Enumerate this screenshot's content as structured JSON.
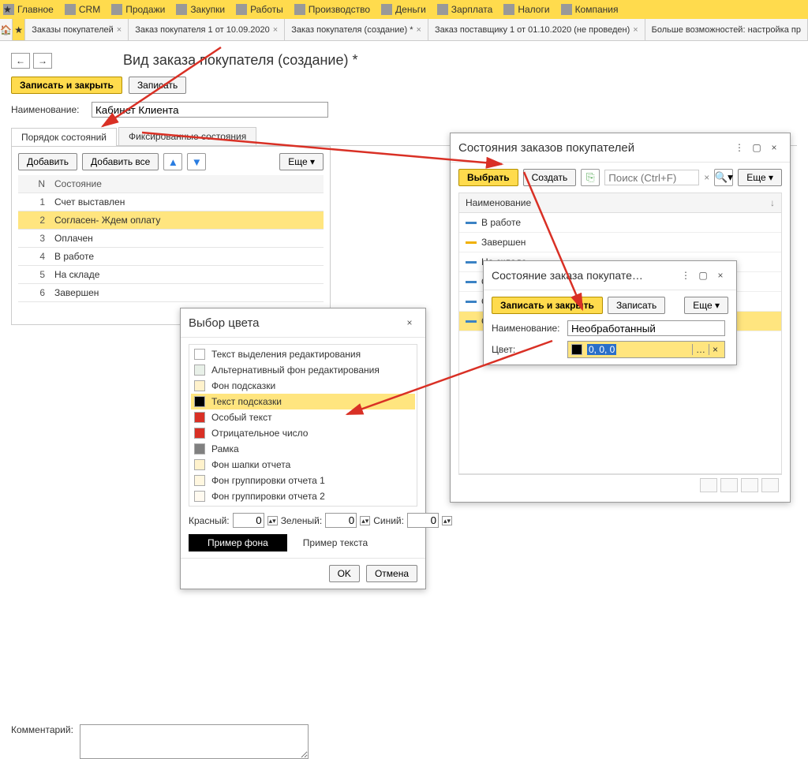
{
  "topmenu": [
    "Главное",
    "CRM",
    "Продажи",
    "Закупки",
    "Работы",
    "Производство",
    "Деньги",
    "Зарплата",
    "Налоги",
    "Компания"
  ],
  "tabs": [
    {
      "label": "Заказы покупателей",
      "close": true
    },
    {
      "label": "Заказ покупателя 1 от 10.09.2020",
      "close": true
    },
    {
      "label": "Заказ покупателя (создание) *",
      "close": true
    },
    {
      "label": "Заказ поставщику 1 от 01.10.2020 (не проведен)",
      "close": true
    },
    {
      "label": "Больше возможностей: настройка пр",
      "close": false
    }
  ],
  "page": {
    "title": "Вид заказа покупателя (создание) *",
    "save_close": "Записать и закрыть",
    "save": "Записать",
    "name_label": "Наименование:",
    "name_value": "Кабинет Клиента",
    "subtab1": "Порядок состояний",
    "subtab2": "Фиксированные состояния",
    "add": "Добавить",
    "add_all": "Добавить все",
    "more": "Еще",
    "col_n": "N",
    "col_state": "Состояние",
    "rows": [
      {
        "n": "1",
        "s": "Счет выставлен"
      },
      {
        "n": "2",
        "s": "Согласен- Ждем оплату"
      },
      {
        "n": "3",
        "s": "Оплачен"
      },
      {
        "n": "4",
        "s": "В работе"
      },
      {
        "n": "5",
        "s": "На складе"
      },
      {
        "n": "6",
        "s": "Завершен"
      }
    ],
    "comment_label": "Комментарий:"
  },
  "color_popup": {
    "title": "Выбор цвета",
    "items": [
      {
        "c": "#ffffff",
        "t": "Текст выделения редактирования"
      },
      {
        "c": "#e8f0e8",
        "t": "Альтернативный фон редактирования"
      },
      {
        "c": "#fff2cc",
        "t": "Фон подсказки"
      },
      {
        "c": "#000000",
        "t": "Текст подсказки"
      },
      {
        "c": "#d93025",
        "t": "Особый текст"
      },
      {
        "c": "#d93025",
        "t": "Отрицательное число"
      },
      {
        "c": "#808080",
        "t": "Рамка"
      },
      {
        "c": "#fff2cc",
        "t": "Фон шапки отчета"
      },
      {
        "c": "#fff7e0",
        "t": "Фон группировки отчета 1"
      },
      {
        "c": "#fffaf0",
        "t": "Фон группировки отчета 2"
      }
    ],
    "selected_index": 3,
    "red_label": "Красный:",
    "green_label": "Зеленый:",
    "blue_label": "Синий:",
    "red": "0",
    "green": "0",
    "blue": "0",
    "sample_bg": "Пример фона",
    "sample_text": "Пример текста",
    "ok": "OK",
    "cancel": "Отмена"
  },
  "states_popup": {
    "title": "Состояния заказов покупателей",
    "select": "Выбрать",
    "create": "Создать",
    "search_placeholder": "Поиск (Ctrl+F)",
    "more": "Еще",
    "col": "Наименование",
    "rows": [
      {
        "c": "#3b82c4",
        "t": "В работе"
      },
      {
        "c": "#f0b000",
        "t": "Завершен"
      },
      {
        "c": "#3b82c4",
        "t": "На складе"
      },
      {
        "c": "#3b82c4",
        "t": "Оплач"
      },
      {
        "c": "#3b82c4",
        "t": "Согла"
      },
      {
        "c": "#3b82c4",
        "t": "Счет в"
      }
    ]
  },
  "edit_popup": {
    "title": "Состояние заказа покупате…",
    "save_close": "Записать и закрыть",
    "save": "Записать",
    "more": "Еще",
    "name_label": "Наименование:",
    "name_value": "Необработанный",
    "color_label": "Цвет:",
    "color_value": "0, 0, 0"
  }
}
